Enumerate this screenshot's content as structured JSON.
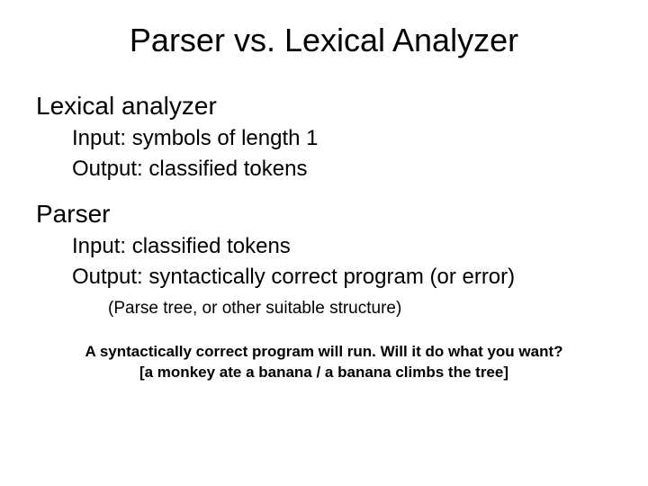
{
  "title": "Parser vs. Lexical Analyzer",
  "lex": {
    "heading": "Lexical analyzer",
    "input": "Input: symbols of length 1",
    "output": "Output: classified tokens"
  },
  "parser": {
    "heading": "Parser",
    "input": "Input: classified tokens",
    "output": "Output: syntactically correct program (or error)",
    "detail": "(Parse tree, or other suitable structure)"
  },
  "note": {
    "line1": "A syntactically correct program will run. Will it do what you want?",
    "line2": "[a monkey ate a banana / a banana climbs the tree]"
  }
}
